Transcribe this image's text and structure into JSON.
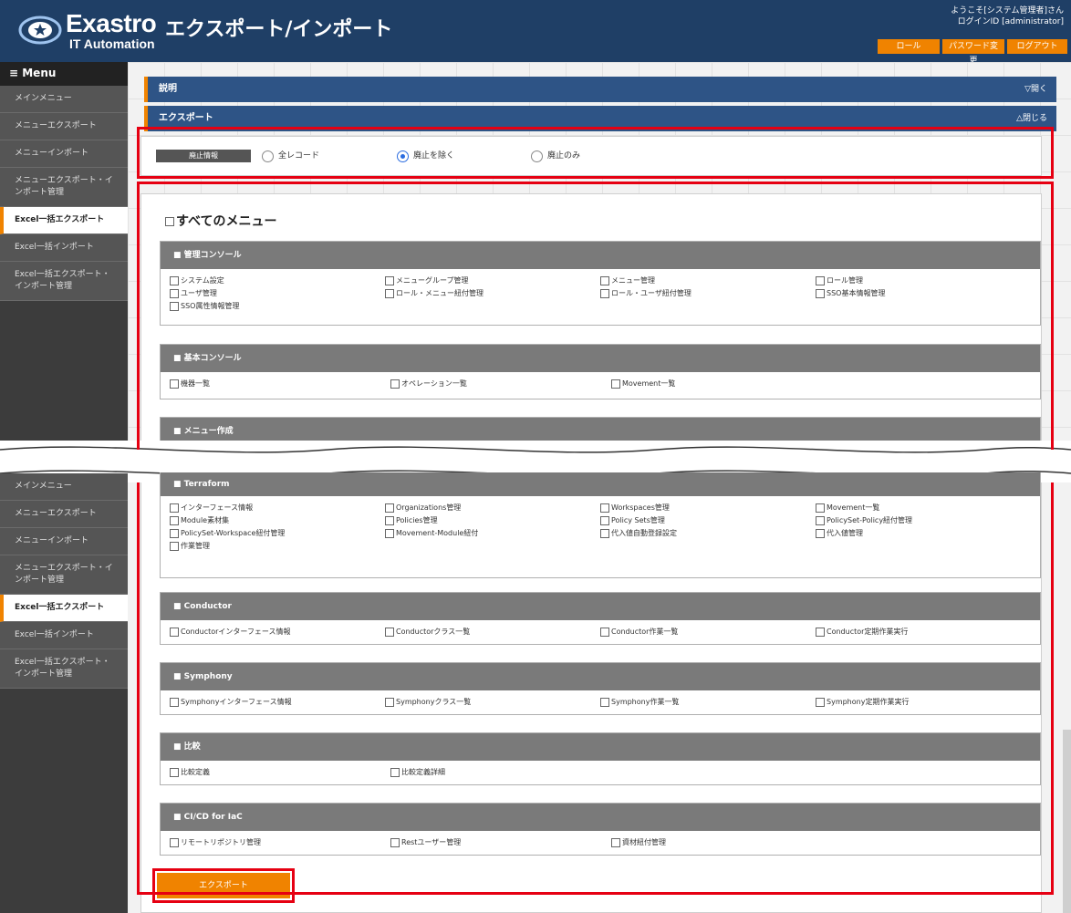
{
  "header": {
    "logo_name": "Exastro",
    "logo_sub": "IT Automation",
    "title": "エクスポート/インポート",
    "welcome_line1": "ようこそ[システム管理者]さん",
    "welcome_line2": "ログインID [administrator]",
    "buttons": [
      "ロール",
      "パスワード変更",
      "ログアウト"
    ]
  },
  "sidebar": {
    "menu_label": "≡ Menu",
    "items": [
      {
        "label": "メインメニュー"
      },
      {
        "label": "メニューエクスポート"
      },
      {
        "label": "メニューインポート"
      },
      {
        "label": "メニューエクスポート・インポート管理"
      },
      {
        "label": "Excel一括エクスポート"
      },
      {
        "label": "Excel一括インポート"
      },
      {
        "label": "Excel一括エクスポート・インポート管理"
      }
    ],
    "active_index": 4
  },
  "bars": {
    "description": {
      "label": "説明",
      "toggle": "▽開く"
    },
    "export": {
      "label": "エクスポート",
      "toggle": "△閉じる"
    }
  },
  "abolish": {
    "tag": "廃止情報",
    "options": [
      {
        "label": "全レコード",
        "checked": false
      },
      {
        "label": "廃止を除く",
        "checked": true
      },
      {
        "label": "廃止のみ",
        "checked": false
      }
    ]
  },
  "all_menu_label": "すべてのメニュー",
  "groups": {
    "kanri": {
      "title": "■ 管理コンソール",
      "rows": [
        [
          "システム設定",
          "メニューグループ管理",
          "メニュー管理",
          "ロール管理"
        ],
        [
          "ユーザ管理",
          "ロール・メニュー紐付管理",
          "ロール・ユーザ紐付管理",
          "SSO基本情報管理"
        ],
        [
          "SSO属性情報管理"
        ]
      ]
    },
    "kihon": {
      "title": "■ 基本コンソール",
      "rows": [
        [
          "機器一覧",
          "オペレーション一覧",
          "Movement一覧"
        ]
      ]
    },
    "menu_create": {
      "title": "■ メニュー作成"
    },
    "terraform": {
      "title": "■ Terraform",
      "rows": [
        [
          "インターフェース情報",
          "Organizations管理",
          "Workspaces管理",
          "Movement一覧"
        ],
        [
          "Module素材集",
          "Policies管理",
          "Policy Sets管理",
          "PolicySet-Policy紐付管理"
        ],
        [
          "PolicySet-Workspace紐付管理",
          "Movement-Module紐付",
          "代入値自動登録設定",
          "代入値管理"
        ],
        [
          "作業管理"
        ]
      ]
    },
    "conductor": {
      "title": "■ Conductor",
      "rows": [
        [
          "Conductorインターフェース情報",
          "Conductorクラス一覧",
          "Conductor作業一覧",
          "Conductor定期作業実行"
        ]
      ]
    },
    "symphony": {
      "title": "■ Symphony",
      "rows": [
        [
          "Symphonyインターフェース情報",
          "Symphonyクラス一覧",
          "Symphony作業一覧",
          "Symphony定期作業実行"
        ]
      ]
    },
    "hikaku": {
      "title": "■ 比較",
      "rows": [
        [
          "比較定義",
          "比較定義詳細"
        ]
      ]
    },
    "cicd": {
      "title": "■ CI/CD for IaC",
      "rows": [
        [
          "リモートリポジトリ管理",
          "Restユーザー管理",
          "資材紐付管理"
        ]
      ]
    }
  },
  "export_button": "エクスポート",
  "colors": {
    "header_bg": "#1f3f66",
    "accent": "#f08300",
    "highlight": "#e60012",
    "bar_bg": "#2e5486"
  }
}
